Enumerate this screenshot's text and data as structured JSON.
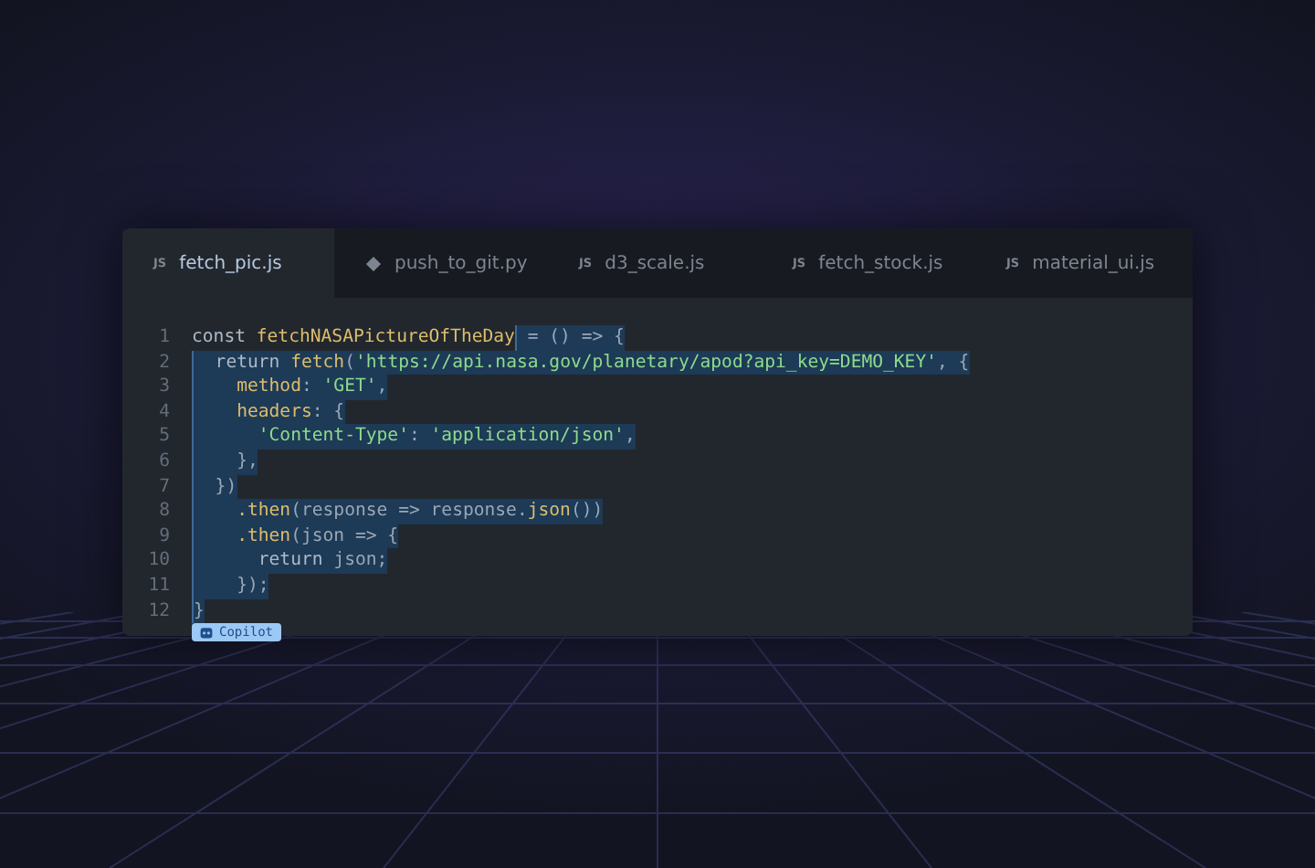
{
  "tabs": [
    {
      "label": "fetch_pic.js",
      "kind": "js",
      "badge": "JS",
      "selected": true
    },
    {
      "label": "push_to_git.py",
      "kind": "py",
      "selected": false
    },
    {
      "label": "d3_scale.js",
      "kind": "js",
      "badge": "JS",
      "selected": false
    },
    {
      "label": "fetch_stock.js",
      "kind": "js",
      "badge": "JS",
      "selected": false
    },
    {
      "label": "material_ui.js",
      "kind": "js",
      "badge": "JS",
      "selected": false
    }
  ],
  "lines": [
    {
      "number": "1",
      "prefix": [
        {
          "text": "const ",
          "kind": "kw"
        },
        {
          "text": "fetchNASAPictureOfTheDay",
          "kind": "fn"
        }
      ],
      "suggestion": [
        {
          "text": " = () => {",
          "kind": "plain"
        }
      ]
    },
    {
      "number": "2",
      "suggestion": [
        {
          "text": "  return ",
          "kind": "kw"
        },
        {
          "text": "fetch",
          "kind": "fn"
        },
        {
          "text": "(",
          "kind": "plain"
        },
        {
          "text": "'https://api.nasa.gov/planetary/apod?api_key=DEMO_KEY'",
          "kind": "str"
        },
        {
          "text": ", {",
          "kind": "plain"
        }
      ]
    },
    {
      "number": "3",
      "suggestion": [
        {
          "text": "    method",
          "kind": "fn"
        },
        {
          "text": ": ",
          "kind": "plain"
        },
        {
          "text": "'GET'",
          "kind": "str"
        },
        {
          "text": ",",
          "kind": "plain"
        }
      ]
    },
    {
      "number": "4",
      "suggestion": [
        {
          "text": "    headers",
          "kind": "fn"
        },
        {
          "text": ": {",
          "kind": "plain"
        }
      ]
    },
    {
      "number": "5",
      "suggestion": [
        {
          "text": "      'Content-Type'",
          "kind": "str"
        },
        {
          "text": ": ",
          "kind": "plain"
        },
        {
          "text": "'application/json'",
          "kind": "str"
        },
        {
          "text": ",",
          "kind": "plain"
        }
      ]
    },
    {
      "number": "6",
      "suggestion": [
        {
          "text": "    },",
          "kind": "plain"
        }
      ]
    },
    {
      "number": "7",
      "suggestion": [
        {
          "text": "  })",
          "kind": "plain"
        }
      ]
    },
    {
      "number": "8",
      "suggestion": [
        {
          "text": "    .then",
          "kind": "fn"
        },
        {
          "text": "(response => response.",
          "kind": "plain"
        },
        {
          "text": "json",
          "kind": "fn"
        },
        {
          "text": "())",
          "kind": "plain"
        }
      ]
    },
    {
      "number": "9",
      "suggestion": [
        {
          "text": "    .then",
          "kind": "fn"
        },
        {
          "text": "(json => {",
          "kind": "plain"
        }
      ]
    },
    {
      "number": "10",
      "suggestion": [
        {
          "text": "      return ",
          "kind": "kw"
        },
        {
          "text": "json;",
          "kind": "plain"
        }
      ]
    },
    {
      "number": "11",
      "suggestion": [
        {
          "text": "    });",
          "kind": "plain"
        }
      ]
    },
    {
      "number": "12",
      "suggestion": [
        {
          "text": "}",
          "kind": "plain"
        }
      ]
    }
  ],
  "copilot_badge": {
    "label": "Copilot"
  }
}
